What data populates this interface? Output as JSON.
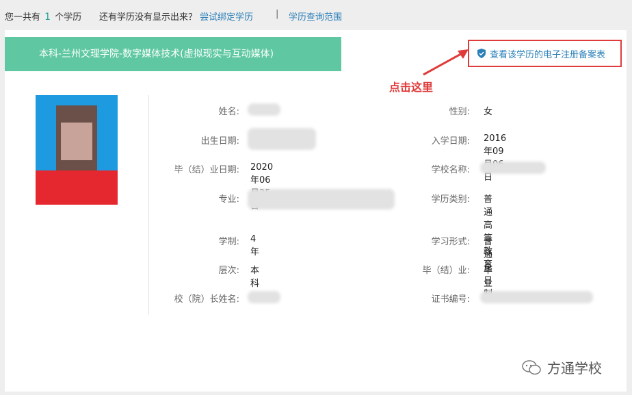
{
  "topbar": {
    "prefix": "您一共有",
    "count": "1",
    "suffix": "个学历",
    "missing_text": "还有学历没有显示出来？",
    "bind_link": "尝试绑定学历",
    "separator": "|",
    "range_link": "学历查询范围"
  },
  "record": {
    "title": "本科-兰州文理学院-数字媒体技术(虚拟现实与互动媒体)",
    "reg_button": "查看该学历的电子注册备案表",
    "annotation": "点击这里"
  },
  "fields_left": [
    {
      "label": "姓名:",
      "value": ""
    },
    {
      "label": "出生日期:",
      "value": ""
    },
    {
      "label": "毕（结）业日期:",
      "value": "2020年06月25日"
    },
    {
      "label": "专业:",
      "value": ""
    },
    {
      "label": "学制:",
      "value": "4 年"
    },
    {
      "label": "层次:",
      "value": "本科"
    },
    {
      "label": "校（院）长姓名:",
      "value": ""
    }
  ],
  "fields_right": [
    {
      "label": "性别:",
      "value": "女"
    },
    {
      "label": "入学日期:",
      "value": "2016年09月06日"
    },
    {
      "label": "学校名称:",
      "value": ""
    },
    {
      "label": "学历类别:",
      "value": "普通高等教育"
    },
    {
      "label": "学习形式:",
      "value": "普通全日制"
    },
    {
      "label": "毕（结）业:",
      "value": "毕业"
    },
    {
      "label": "证书编号:",
      "value": ""
    }
  ],
  "watermark": "方通学校",
  "colors": {
    "accent": "#5fc8a2",
    "link": "#2a7fb8",
    "highlight": "#e03b3b"
  }
}
